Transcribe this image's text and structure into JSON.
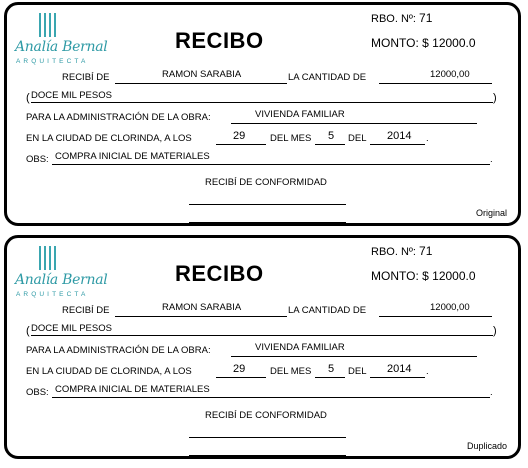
{
  "receipts": [
    {
      "brand": "Analía Bernal",
      "brand_sub": "ARQUITECTA",
      "title": "RECIBO",
      "rbo_label": "RBO. Nº:",
      "rbo_number": "71",
      "monto_label": "MONTO: $",
      "monto_value": "12000.0",
      "received_from_label": "RECIBÍ DE",
      "received_from": "RAMON SARABIA",
      "amount_label": "LA CANTIDAD DE",
      "amount_number": "12000,00",
      "amount_words": "DOCE MIL PESOS",
      "admin_label": "PARA LA ADMINISTRACIÓN DE LA OBRA:",
      "work": "VIVIENDA FAMILIAR",
      "city_label": "EN LA CIUDAD DE CLORINDA, A LOS",
      "day": "29",
      "month_label": "DEL MES",
      "month": "5",
      "year_label": "DEL",
      "year": "2014",
      "obs_label": "OBS:",
      "obs": "COMPRA INICIAL DE MATERIALES",
      "conformity_label": "RECIBÍ DE CONFORMIDAD",
      "copy_label": "Original"
    },
    {
      "brand": "Analía Bernal",
      "brand_sub": "ARQUITECTA",
      "title": "RECIBO",
      "rbo_label": "RBO. Nº:",
      "rbo_number": "71",
      "monto_label": "MONTO: $",
      "monto_value": "12000.0",
      "received_from_label": "RECIBÍ DE",
      "received_from": "RAMON SARABIA",
      "amount_label": "LA CANTIDAD DE",
      "amount_number": "12000,00",
      "amount_words": "DOCE MIL PESOS",
      "admin_label": "PARA LA ADMINISTRACIÓN DE LA OBRA:",
      "work": "VIVIENDA FAMILIAR",
      "city_label": "EN LA CIUDAD DE CLORINDA, A LOS",
      "day": "29",
      "month_label": "DEL MES",
      "month": "5",
      "year_label": "DEL",
      "year": "2014",
      "obs_label": "OBS:",
      "obs": "COMPRA INICIAL DE MATERIALES",
      "conformity_label": "RECIBÍ DE CONFORMIDAD",
      "copy_label": "Duplicado"
    }
  ],
  "colors": {
    "brand": "#2e9aa5",
    "border": "#000000"
  }
}
